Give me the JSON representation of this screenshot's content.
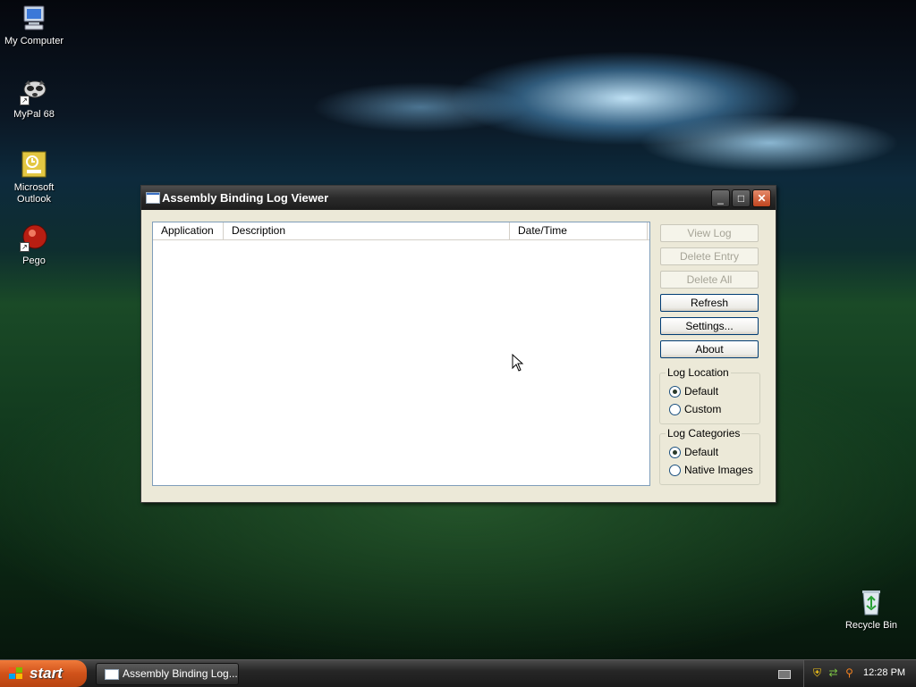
{
  "desktop": {
    "icons": [
      {
        "name": "my-computer",
        "label": "My Computer"
      },
      {
        "name": "mypal",
        "label": "MyPal 68"
      },
      {
        "name": "outlook",
        "label": "Microsoft Outlook"
      },
      {
        "name": "pego",
        "label": "Pego"
      },
      {
        "name": "recycle-bin",
        "label": "Recycle Bin"
      }
    ]
  },
  "window": {
    "title": "Assembly Binding Log Viewer",
    "controls": {
      "minimize": "_",
      "maximize": "□",
      "close": "✕"
    },
    "list": {
      "columns": [
        "Application",
        "Description",
        "Date/Time"
      ],
      "rows": []
    },
    "buttons": {
      "view_log": "View Log",
      "delete_entry": "Delete Entry",
      "delete_all": "Delete All",
      "refresh": "Refresh",
      "settings": "Settings...",
      "about": "About"
    },
    "log_location": {
      "label": "Log Location",
      "options": [
        "Default",
        "Custom"
      ],
      "selected": "Default"
    },
    "log_categories": {
      "label": "Log Categories",
      "options": [
        "Default",
        "Native Images"
      ],
      "selected": "Default"
    }
  },
  "taskbar": {
    "start_label": "start",
    "task_label": "Assembly Binding Log...",
    "clock": "12:28 PM"
  }
}
